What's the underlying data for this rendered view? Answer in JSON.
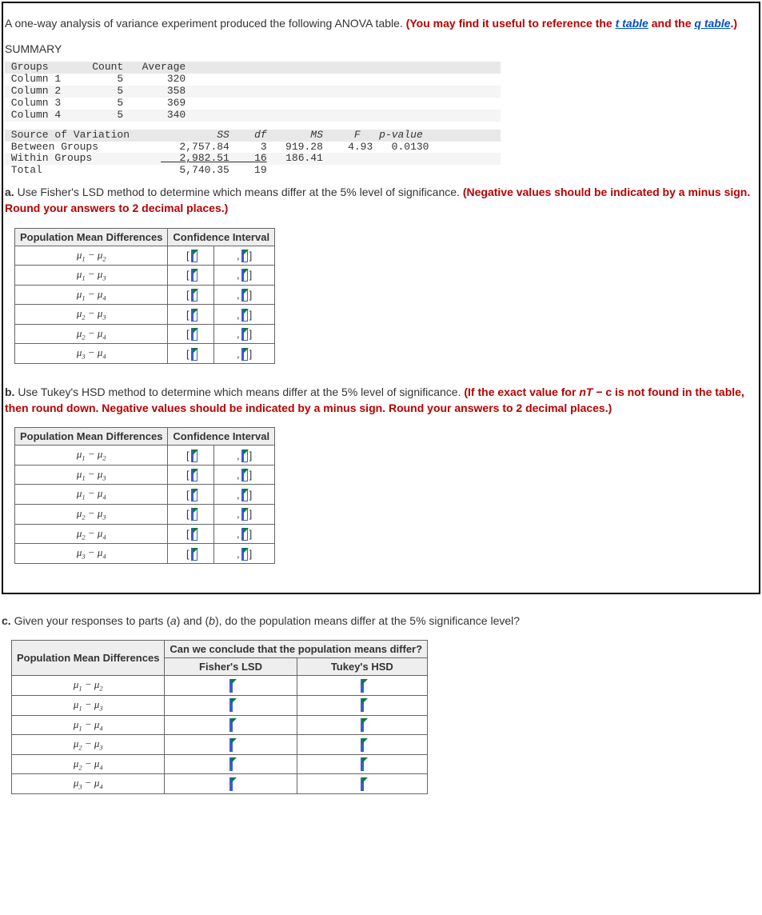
{
  "intro": {
    "lead": "A one-way analysis of variance experiment produced the following ANOVA table. ",
    "note_prefix": "(You may find it useful to reference the ",
    "t_link": "t table",
    "and_word": " and the ",
    "q_link": "q table",
    "note_suffix": ".)"
  },
  "summary_label": "SUMMARY",
  "summary_table": {
    "headers": {
      "groups": "Groups",
      "count": "Count",
      "average": "Average"
    },
    "rows": [
      {
        "g": "Column 1",
        "c": "5",
        "a": "320"
      },
      {
        "g": "Column 2",
        "c": "5",
        "a": "358"
      },
      {
        "g": "Column 3",
        "c": "5",
        "a": "369"
      },
      {
        "g": "Column 4",
        "c": "5",
        "a": "340"
      }
    ]
  },
  "anova_table": {
    "headers": {
      "src": "Source of Variation",
      "ss": "SS",
      "df": "df",
      "ms": "MS",
      "f": "F",
      "p": "p-value"
    },
    "rows": [
      {
        "src": "Between Groups",
        "ss": "2,757.84",
        "df": "3",
        "ms": "919.28",
        "f": "4.93",
        "p": "0.0130"
      },
      {
        "src": "Within Groups",
        "ss": "2,982.51",
        "df": "16",
        "ms": "186.41",
        "f": "",
        "p": ""
      }
    ],
    "total": {
      "src": "Total",
      "ss": "5,740.35",
      "df": "19"
    }
  },
  "parts": {
    "a": {
      "label": "a.",
      "text_main": " Use Fisher's LSD method to determine which means differ at the 5% level of significance. ",
      "text_note": "(Negative values should be indicated by a minus sign. Round your answers to 2 decimal places.)"
    },
    "b": {
      "label": "b.",
      "text_main": " Use Tukey's HSD method to determine which means differ at the 5% level of significance. ",
      "text_note_prefix": "(If the exact value for ",
      "nt": "nT",
      "minus_c": "− c",
      "text_note_suffix": " is not found in the table, then round down. Negative values should be indicated by a minus sign. Round your answers to 2 decimal places.)"
    },
    "c": {
      "label": "c.",
      "text_main": " Given your responses to parts (",
      "a_i": "a",
      "mid": ") and (",
      "b_i": "b",
      "text_end": "), do the population means differ at the 5% significance level?"
    }
  },
  "ci_table": {
    "col1": "Population Mean Differences",
    "col2": "Confidence Interval",
    "rows": [
      "1−2",
      "1−3",
      "1−4",
      "2−3",
      "2−4",
      "3−4"
    ]
  },
  "c_table": {
    "col1": "Population Mean Differences",
    "col2": "Can we conclude that the population means differ?",
    "sub_fisher": "Fisher's LSD",
    "sub_tukey": "Tukey's HSD"
  }
}
